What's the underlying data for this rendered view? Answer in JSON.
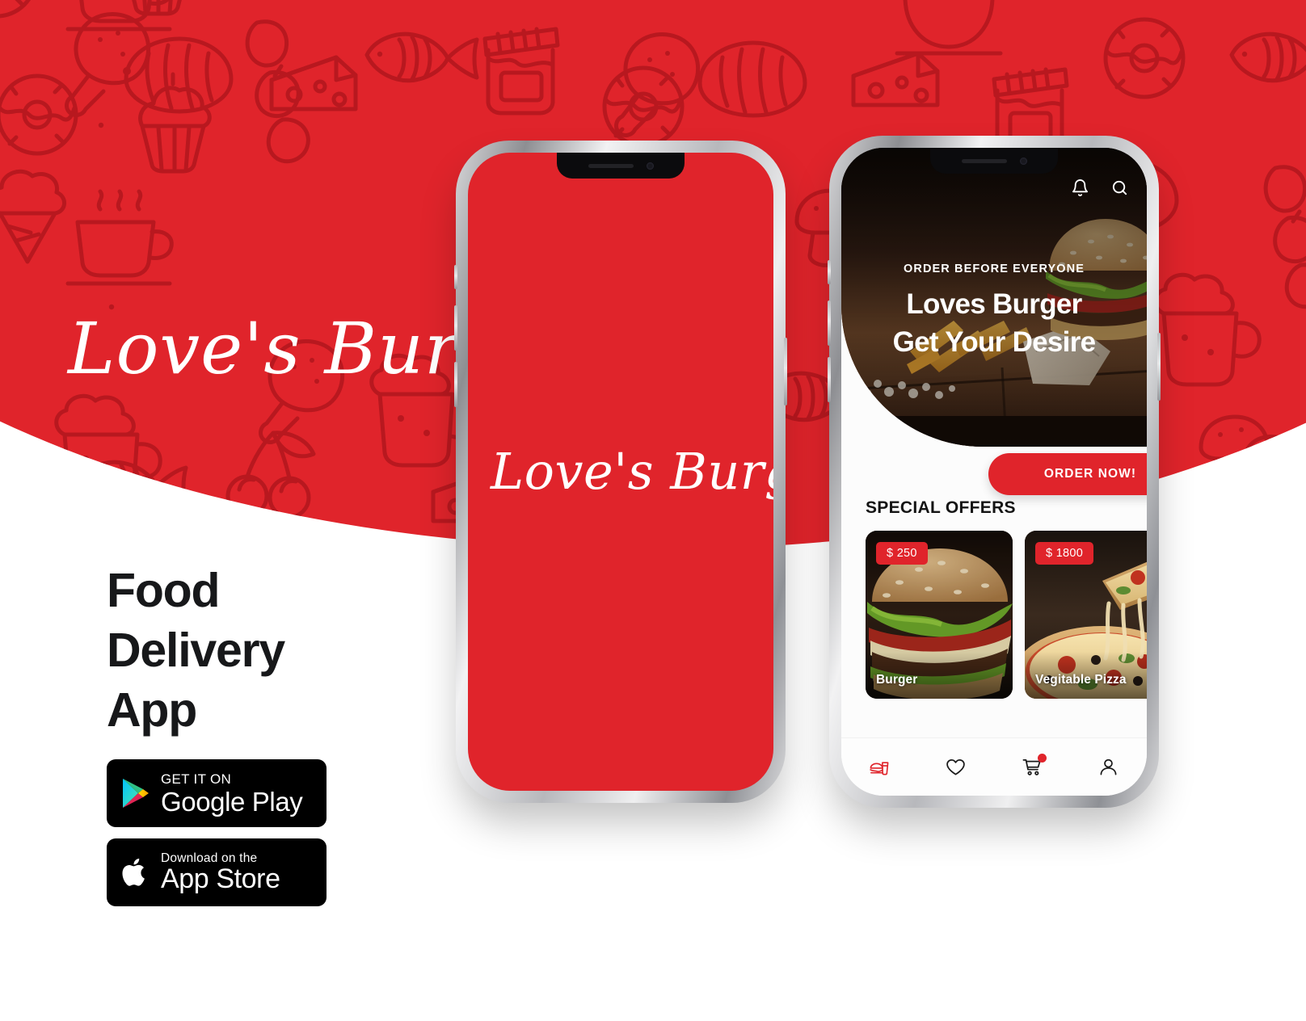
{
  "brand": {
    "logo_text": "Love's Burger",
    "accent_red": "#E0242B",
    "pattern_red": "#B8181F",
    "ink": "#17181A"
  },
  "headline": {
    "line1": "Food",
    "line2": "Delivery",
    "line3": "App"
  },
  "store_badges": [
    {
      "id": "google-play",
      "small": "GET IT ON",
      "big": "Google Play",
      "icon": "google-play-icon"
    },
    {
      "id": "app-store",
      "small": "Download on the",
      "big": "App Store",
      "icon": "apple-icon"
    }
  ],
  "phone_splash": {
    "logo_text": "Love's Burger",
    "screen_color": "#E0242B"
  },
  "phone_home": {
    "hero": {
      "kicker": "ORDER BEFORE EVERYONE",
      "title_line1": "Loves Burger",
      "title_line2": "Get Your Desire",
      "icons": [
        {
          "name": "bell-icon",
          "label": "Notifications"
        },
        {
          "name": "search-icon",
          "label": "Search"
        }
      ]
    },
    "order_button": "ORDER NOW!",
    "section_title": "SPECIAL OFFERS",
    "offers": [
      {
        "price": "$ 250",
        "name": "Burger"
      },
      {
        "price": "$ 1800",
        "name": "Vegitable Pizza"
      }
    ],
    "tabbar": [
      {
        "name": "food-icon",
        "label": "Food",
        "active": true,
        "badge": false
      },
      {
        "name": "heart-icon",
        "label": "Favorites",
        "active": false,
        "badge": false
      },
      {
        "name": "cart-icon",
        "label": "Cart",
        "active": false,
        "badge": true
      },
      {
        "name": "person-icon",
        "label": "Profile",
        "active": false,
        "badge": false
      }
    ]
  }
}
